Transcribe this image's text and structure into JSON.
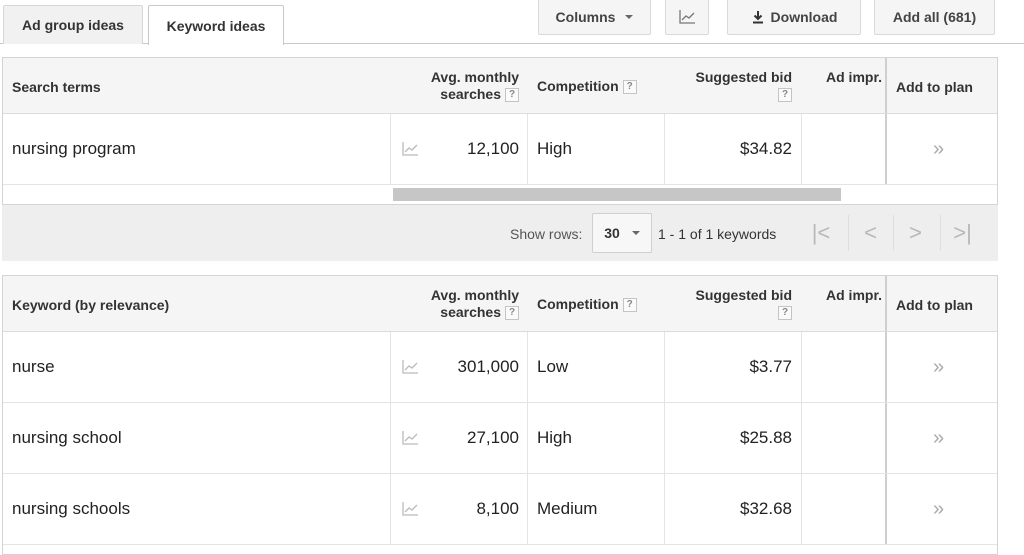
{
  "tabs": [
    {
      "label": "Ad group ideas",
      "active": false
    },
    {
      "label": "Keyword ideas",
      "active": true
    }
  ],
  "toolbar": {
    "columns_label": "Columns",
    "chart_icon": "line-chart-icon",
    "download_label": "Download",
    "download_icon": "download-icon",
    "add_all_label": "Add all (681)"
  },
  "search_terms_table": {
    "headers": {
      "term": "Search terms",
      "avg_line1": "Avg. monthly",
      "avg_line2": "searches",
      "competition": "Competition",
      "bid_line1": "Suggested bid",
      "ad_impr": "Ad impr.",
      "add_to_plan": "Add to plan",
      "help": "?"
    },
    "rows": [
      {
        "term": "nursing program",
        "searches": "12,100",
        "competition": "High",
        "bid": "$34.82",
        "add": "»"
      }
    ]
  },
  "pager": {
    "show_rows_label": "Show rows:",
    "rows_value": "30",
    "range_text": "1 - 1 of 1 keywords",
    "first": "|<",
    "prev": "<",
    "next": ">",
    "last": ">|"
  },
  "keyword_table": {
    "headers": {
      "term": "Keyword (by relevance)",
      "avg_line1": "Avg. monthly",
      "avg_line2": "searches",
      "competition": "Competition",
      "bid_line1": "Suggested bid",
      "ad_impr": "Ad impr.",
      "add_to_plan": "Add to plan",
      "help": "?"
    },
    "rows": [
      {
        "term": "nurse",
        "searches": "301,000",
        "competition": "Low",
        "bid": "$3.77",
        "add": "»"
      },
      {
        "term": "nursing school",
        "searches": "27,100",
        "competition": "High",
        "bid": "$25.88",
        "add": "»"
      },
      {
        "term": "nursing schools",
        "searches": "8,100",
        "competition": "Medium",
        "bid": "$32.68",
        "add": "»"
      }
    ]
  }
}
